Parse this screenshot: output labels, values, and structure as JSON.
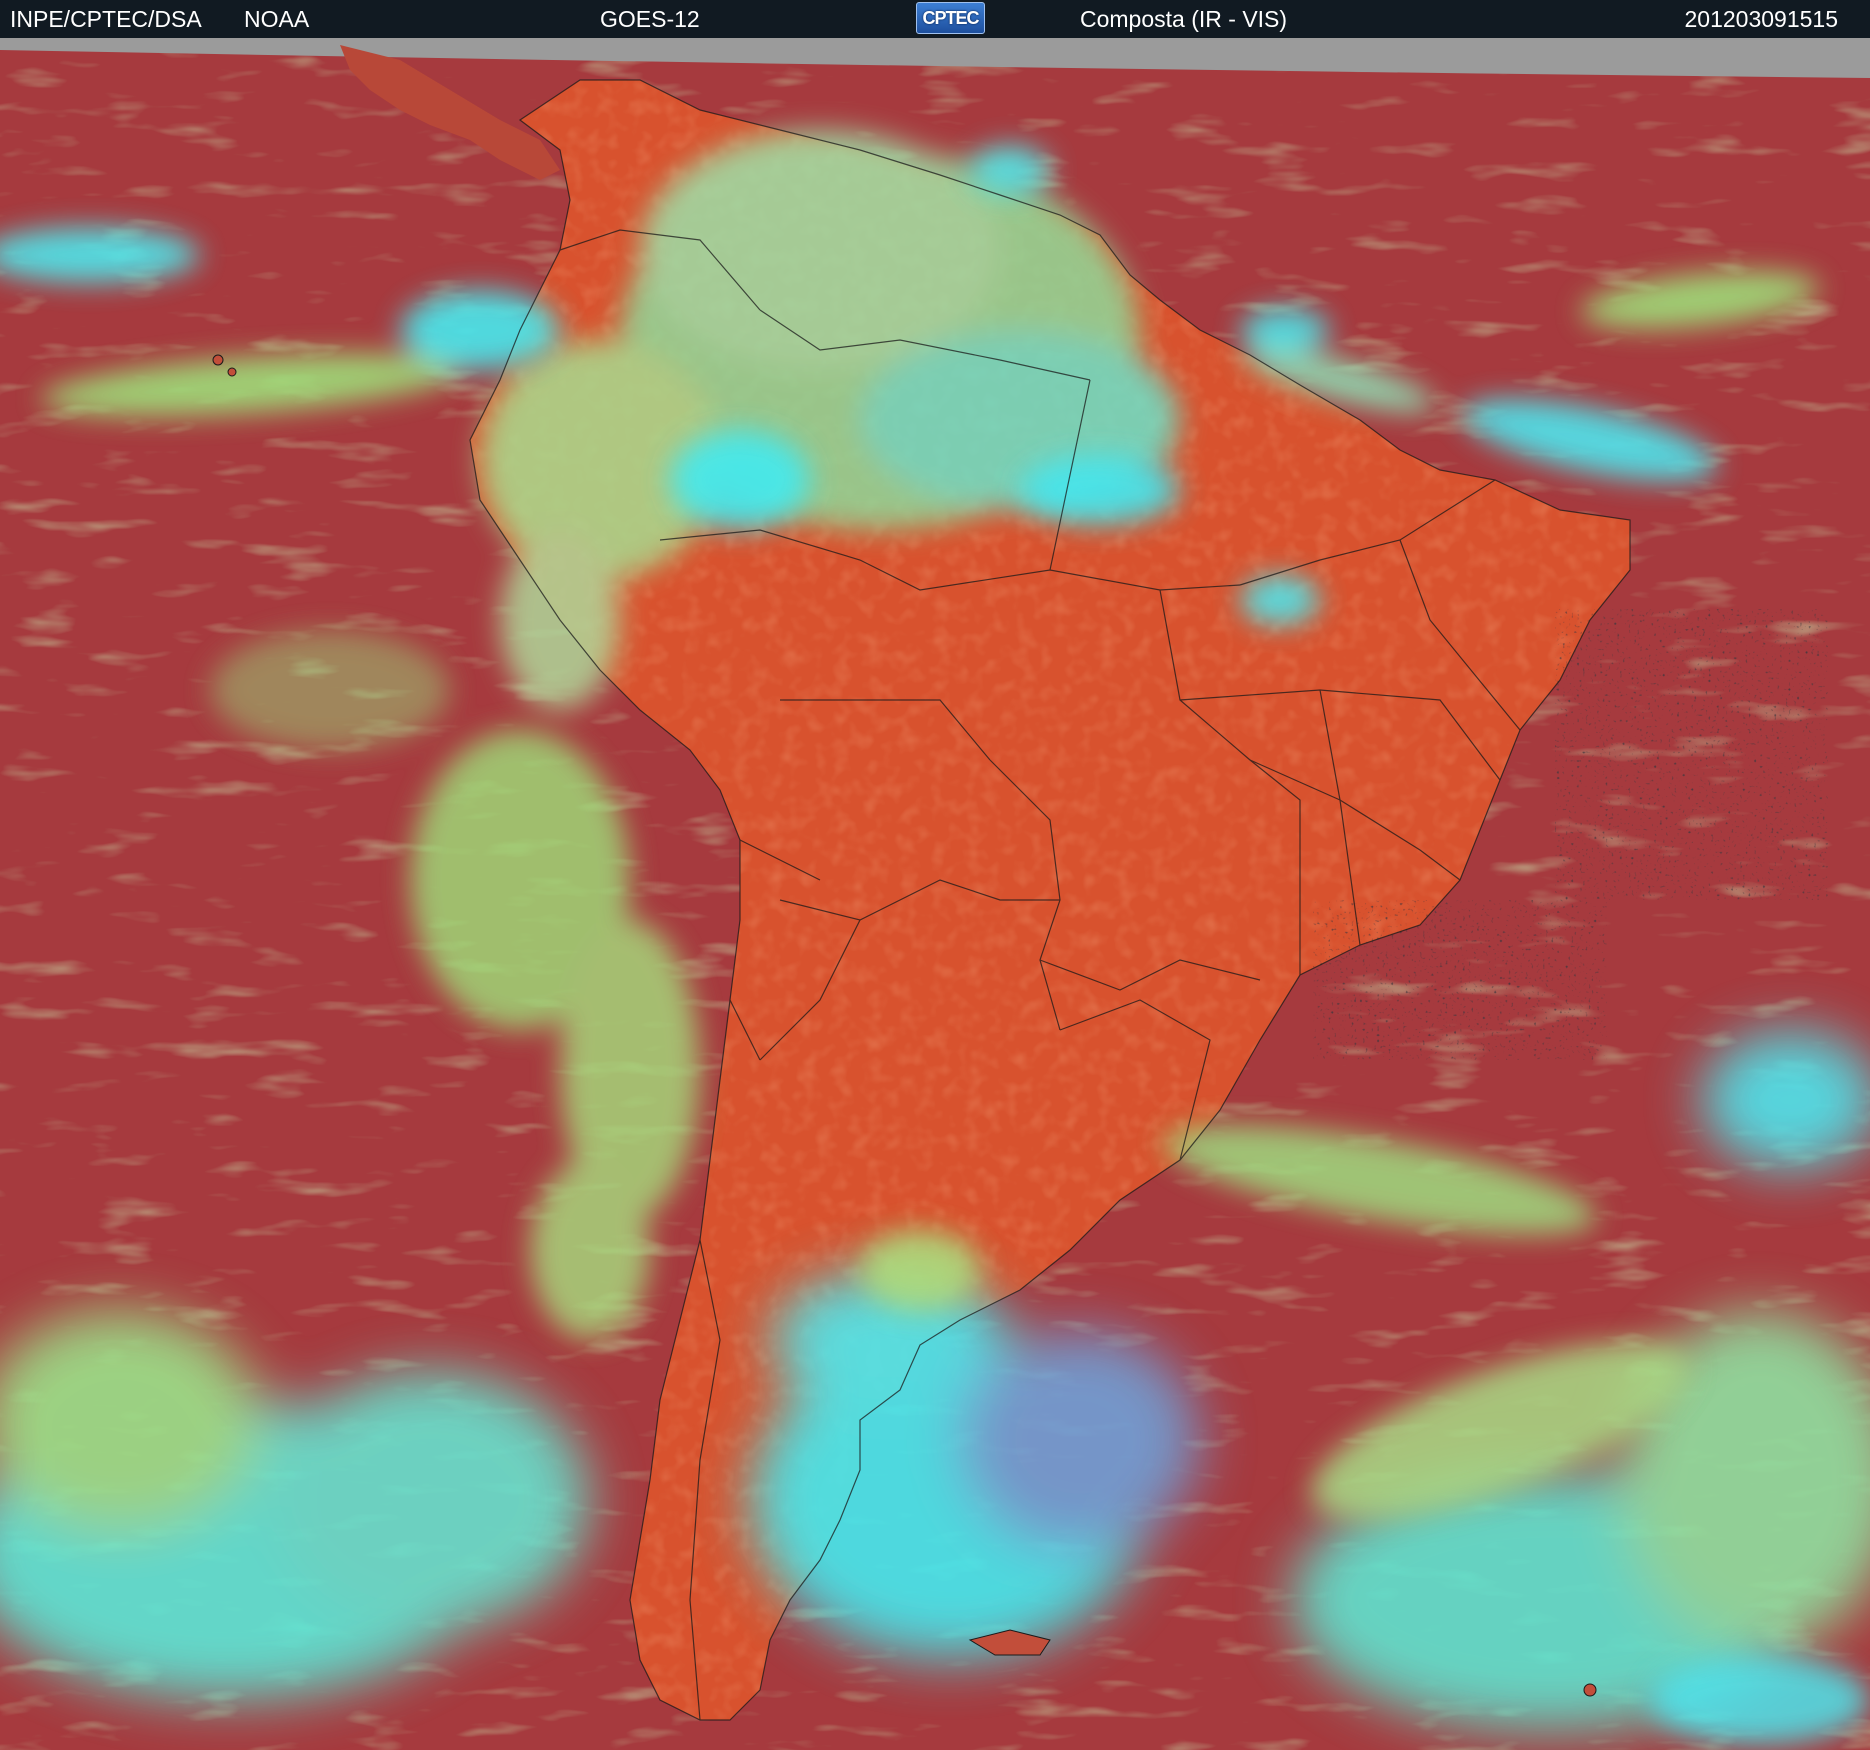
{
  "header": {
    "institution": "INPE/CPTEC/DSA",
    "agency": "NOAA",
    "satellite": "GOES-12",
    "logo_text": "CPTEC",
    "product": "Composta (IR - VIS)",
    "timestamp": "201203091515"
  },
  "colors": {
    "header_background": "#111a22",
    "header_text": "#ffffff",
    "clear_ocean": "#a63a3e",
    "land_surface": "#d8522e",
    "low_cloud": "#9ee27a",
    "high_cloud": "#3fe8ec",
    "missing_data_band": "#9b9b9b",
    "boundaries": "#1a1a1a"
  },
  "map": {
    "region": "South America",
    "layers": [
      "composite-ir-vis-imagery",
      "country-boundaries",
      "state-boundaries"
    ]
  }
}
